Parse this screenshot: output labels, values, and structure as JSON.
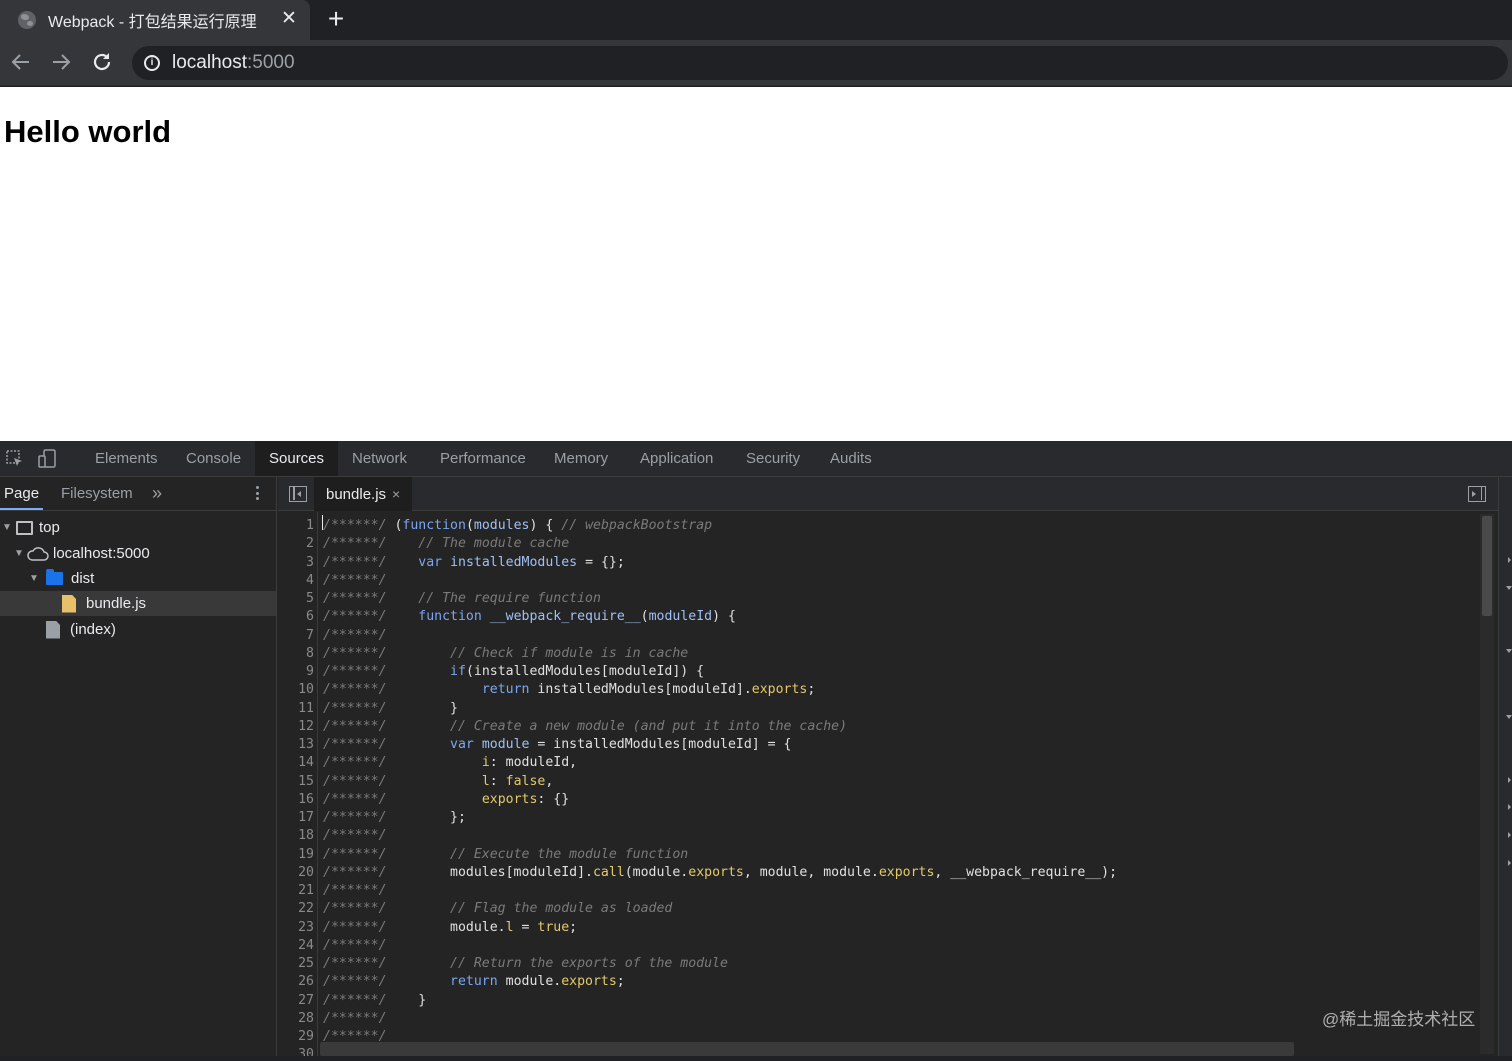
{
  "browser": {
    "tab_title": "Webpack - 打包结果运行原理",
    "tab_close": "✕",
    "new_tab": "+",
    "url_host": "localhost",
    "url_port": ":5000"
  },
  "page": {
    "heading": "Hello world"
  },
  "devtools": {
    "tabs": [
      "Elements",
      "Console",
      "Sources",
      "Network",
      "Performance",
      "Memory",
      "Application",
      "Security",
      "Audits"
    ],
    "active_tab": "Sources",
    "navigator_tabs": {
      "page": "Page",
      "filesystem": "Filesystem",
      "more": "»"
    },
    "tree": {
      "top": "top",
      "host": "localhost:5000",
      "folder": "dist",
      "file": "bundle.js",
      "index": "(index)"
    },
    "editor": {
      "file_tab": "bundle.js",
      "close": "×"
    },
    "code": [
      {
        "n": "1",
        "parts": [
          [
            "pre",
            "/******/ "
          ],
          [
            "pln",
            "("
          ],
          [
            "kw",
            "function"
          ],
          [
            "pln",
            "("
          ],
          [
            "var",
            "modules"
          ],
          [
            "pln",
            ") { "
          ],
          [
            "cmt",
            "// webpackBootstrap"
          ]
        ]
      },
      {
        "n": "2",
        "parts": [
          [
            "pre",
            "/******/ "
          ],
          [
            "pln",
            "   "
          ],
          [
            "cmt",
            "// The module cache"
          ]
        ]
      },
      {
        "n": "3",
        "parts": [
          [
            "pre",
            "/******/ "
          ],
          [
            "pln",
            "   "
          ],
          [
            "kw",
            "var"
          ],
          [
            "pln",
            " "
          ],
          [
            "var",
            "installedModules"
          ],
          [
            "pln",
            " = {};"
          ]
        ]
      },
      {
        "n": "4",
        "parts": [
          [
            "pre",
            "/******/"
          ]
        ]
      },
      {
        "n": "5",
        "parts": [
          [
            "pre",
            "/******/ "
          ],
          [
            "pln",
            "   "
          ],
          [
            "cmt",
            "// The require function"
          ]
        ]
      },
      {
        "n": "6",
        "parts": [
          [
            "pre",
            "/******/ "
          ],
          [
            "pln",
            "   "
          ],
          [
            "kw",
            "function"
          ],
          [
            "pln",
            " "
          ],
          [
            "fn",
            "__webpack_require__"
          ],
          [
            "pln",
            "("
          ],
          [
            "var",
            "moduleId"
          ],
          [
            "pln",
            ") {"
          ]
        ]
      },
      {
        "n": "7",
        "parts": [
          [
            "pre",
            "/******/"
          ]
        ]
      },
      {
        "n": "8",
        "parts": [
          [
            "pre",
            "/******/ "
          ],
          [
            "pln",
            "       "
          ],
          [
            "cmt",
            "// Check if module is in cache"
          ]
        ]
      },
      {
        "n": "9",
        "parts": [
          [
            "pre",
            "/******/ "
          ],
          [
            "pln",
            "       "
          ],
          [
            "kw",
            "if"
          ],
          [
            "pln",
            "(installedModules[moduleId]) {"
          ]
        ]
      },
      {
        "n": "10",
        "parts": [
          [
            "pre",
            "/******/ "
          ],
          [
            "pln",
            "           "
          ],
          [
            "kw",
            "return"
          ],
          [
            "pln",
            " installedModules[moduleId]."
          ],
          [
            "prop",
            "exports"
          ],
          [
            "pln",
            ";"
          ]
        ]
      },
      {
        "n": "11",
        "parts": [
          [
            "pre",
            "/******/ "
          ],
          [
            "pln",
            "       }"
          ]
        ]
      },
      {
        "n": "12",
        "parts": [
          [
            "pre",
            "/******/ "
          ],
          [
            "pln",
            "       "
          ],
          [
            "cmt",
            "// Create a new module (and put it into the cache)"
          ]
        ]
      },
      {
        "n": "13",
        "parts": [
          [
            "pre",
            "/******/ "
          ],
          [
            "pln",
            "       "
          ],
          [
            "kw",
            "var"
          ],
          [
            "pln",
            " "
          ],
          [
            "var",
            "module"
          ],
          [
            "pln",
            " = installedModules[moduleId] = {"
          ]
        ]
      },
      {
        "n": "14",
        "parts": [
          [
            "pre",
            "/******/ "
          ],
          [
            "pln",
            "           "
          ],
          [
            "prop",
            "i"
          ],
          [
            "pln",
            ": moduleId,"
          ]
        ]
      },
      {
        "n": "15",
        "parts": [
          [
            "pre",
            "/******/ "
          ],
          [
            "pln",
            "           "
          ],
          [
            "prop",
            "l"
          ],
          [
            "pln",
            ": "
          ],
          [
            "prop",
            "false"
          ],
          [
            "pln",
            ","
          ]
        ]
      },
      {
        "n": "16",
        "parts": [
          [
            "pre",
            "/******/ "
          ],
          [
            "pln",
            "           "
          ],
          [
            "prop",
            "exports"
          ],
          [
            "pln",
            ": {}"
          ]
        ]
      },
      {
        "n": "17",
        "parts": [
          [
            "pre",
            "/******/ "
          ],
          [
            "pln",
            "       };"
          ]
        ]
      },
      {
        "n": "18",
        "parts": [
          [
            "pre",
            "/******/"
          ]
        ]
      },
      {
        "n": "19",
        "parts": [
          [
            "pre",
            "/******/ "
          ],
          [
            "pln",
            "       "
          ],
          [
            "cmt",
            "// Execute the module function"
          ]
        ]
      },
      {
        "n": "20",
        "parts": [
          [
            "pre",
            "/******/ "
          ],
          [
            "pln",
            "       modules[moduleId]."
          ],
          [
            "prop",
            "call"
          ],
          [
            "pln",
            "(module."
          ],
          [
            "prop",
            "exports"
          ],
          [
            "pln",
            ", module, module."
          ],
          [
            "prop",
            "exports"
          ],
          [
            "pln",
            ", __webpack_require__);"
          ]
        ]
      },
      {
        "n": "21",
        "parts": [
          [
            "pre",
            "/******/"
          ]
        ]
      },
      {
        "n": "22",
        "parts": [
          [
            "pre",
            "/******/ "
          ],
          [
            "pln",
            "       "
          ],
          [
            "cmt",
            "// Flag the module as loaded"
          ]
        ]
      },
      {
        "n": "23",
        "parts": [
          [
            "pre",
            "/******/ "
          ],
          [
            "pln",
            "       module."
          ],
          [
            "prop",
            "l"
          ],
          [
            "pln",
            " = "
          ],
          [
            "prop",
            "true"
          ],
          [
            "pln",
            ";"
          ]
        ]
      },
      {
        "n": "24",
        "parts": [
          [
            "pre",
            "/******/"
          ]
        ]
      },
      {
        "n": "25",
        "parts": [
          [
            "pre",
            "/******/ "
          ],
          [
            "pln",
            "       "
          ],
          [
            "cmt",
            "// Return the exports of the module"
          ]
        ]
      },
      {
        "n": "26",
        "parts": [
          [
            "pre",
            "/******/ "
          ],
          [
            "pln",
            "       "
          ],
          [
            "kw",
            "return"
          ],
          [
            "pln",
            " module."
          ],
          [
            "prop",
            "exports"
          ],
          [
            "pln",
            ";"
          ]
        ]
      },
      {
        "n": "27",
        "parts": [
          [
            "pre",
            "/******/ "
          ],
          [
            "pln",
            "   }"
          ]
        ]
      },
      {
        "n": "28",
        "parts": [
          [
            "pre",
            "/******/"
          ]
        ]
      },
      {
        "n": "29",
        "parts": [
          [
            "pre",
            "/******/"
          ]
        ]
      },
      {
        "n": "30",
        "parts": []
      }
    ]
  },
  "watermark": "@稀土掘金技术社区",
  "colors": {
    "accent": "#7cacf8",
    "keyword": "#7ba6f0",
    "property": "#e3c96a",
    "comment": "#7a7a7a"
  }
}
